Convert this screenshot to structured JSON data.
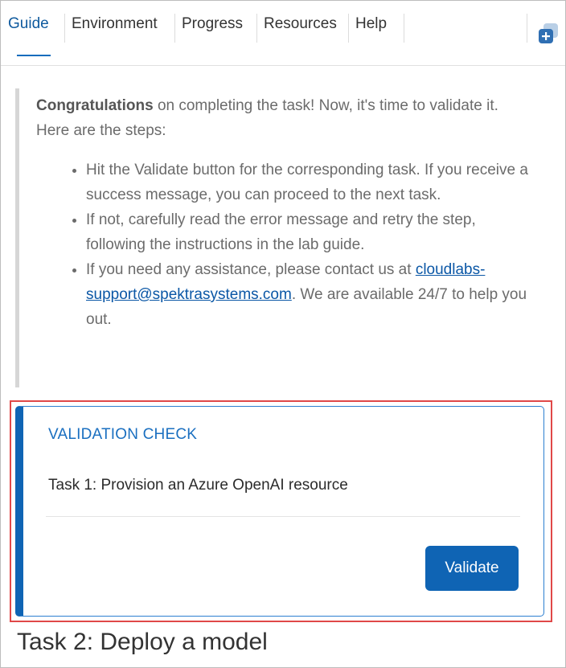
{
  "tabs": [
    {
      "label": "Guide",
      "active": true
    },
    {
      "label": "Environment",
      "active": false
    },
    {
      "label": "Progress",
      "active": false
    },
    {
      "label": "Resources",
      "active": false
    },
    {
      "label": "Help",
      "active": false
    }
  ],
  "corner_icon": "add-stack-icon",
  "intro": {
    "bold": "Congratulations",
    "rest": " on completing the task! Now, it's time to validate it. Here are the steps:"
  },
  "steps": {
    "step1": "Hit the Validate button for the corresponding task. If you receive a success message, you can proceed to the next task.",
    "step2": "If not, carefully read the error message and retry the step, following the instructions in the lab guide.",
    "step3_before": "If you need any assistance, please contact us at ",
    "step3_link": "cloudlabs-support@spektrasystems.com",
    "step3_after": ". We are available 24/7 to help you out."
  },
  "validation": {
    "title": "VALIDATION CHECK",
    "task": "Task 1: Provision an Azure OpenAI resource",
    "button_label": "Validate"
  },
  "next_heading": "Task 2: Deploy a model",
  "colors": {
    "accent": "#0f64b4",
    "highlight_border": "#e04848",
    "link": "#0b57a6"
  }
}
